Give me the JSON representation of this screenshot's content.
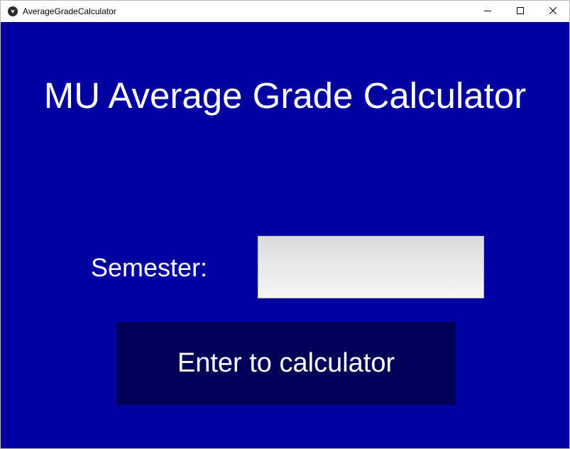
{
  "window": {
    "title": "AverageGradeCalculator",
    "app_icon": "kivy-logo-icon",
    "controls": {
      "minimize_icon": "minimize-icon",
      "maximize_icon": "maximize-icon",
      "close_icon": "close-icon"
    }
  },
  "main": {
    "heading": "MU Average Grade Calculator",
    "semester_label": "Semester:",
    "semester_input_value": "",
    "enter_button_label": "Enter to calculator"
  },
  "colors": {
    "background": "#0000a0",
    "button_background": "#000058",
    "text": "#ffffff"
  }
}
